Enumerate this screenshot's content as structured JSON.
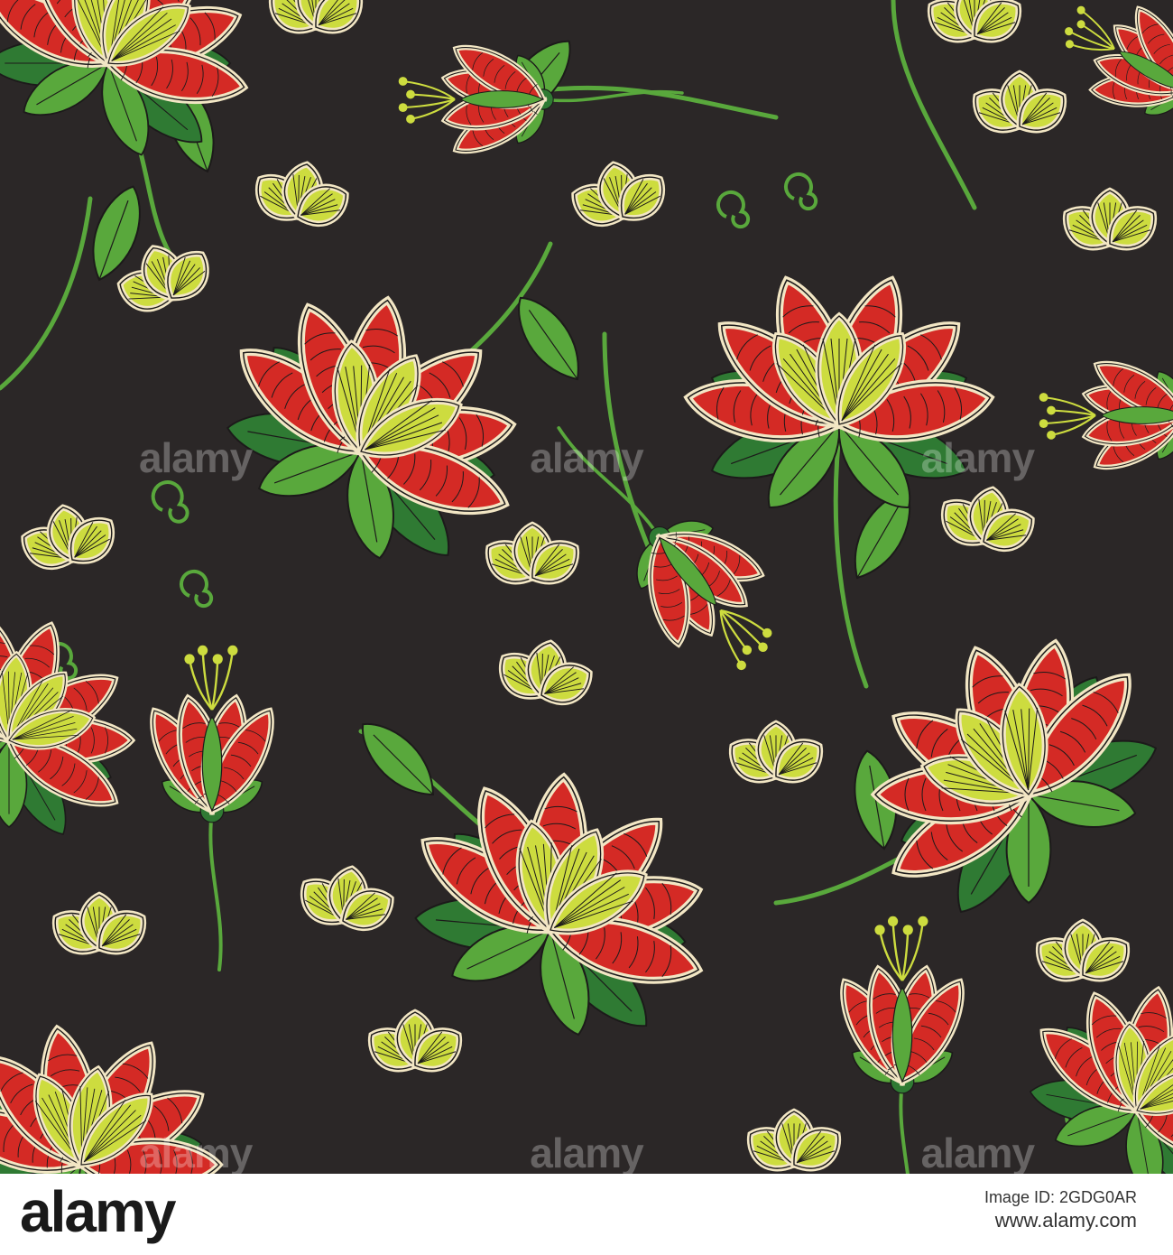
{
  "pattern": {
    "background_color": "#2b2727",
    "colors": {
      "petal_red": "#d42a25",
      "leaf_green": "#59a83c",
      "dark_green": "#2f7a33",
      "lime": "#cddc3f",
      "cream_outline": "#f2e6c4",
      "line": "#1c1a1a"
    },
    "watermark_text": "alamy"
  },
  "footer": {
    "logo_text": "alamy",
    "image_id_label": "Image ID: 2GDG0AR",
    "site": "www.alamy.com"
  }
}
